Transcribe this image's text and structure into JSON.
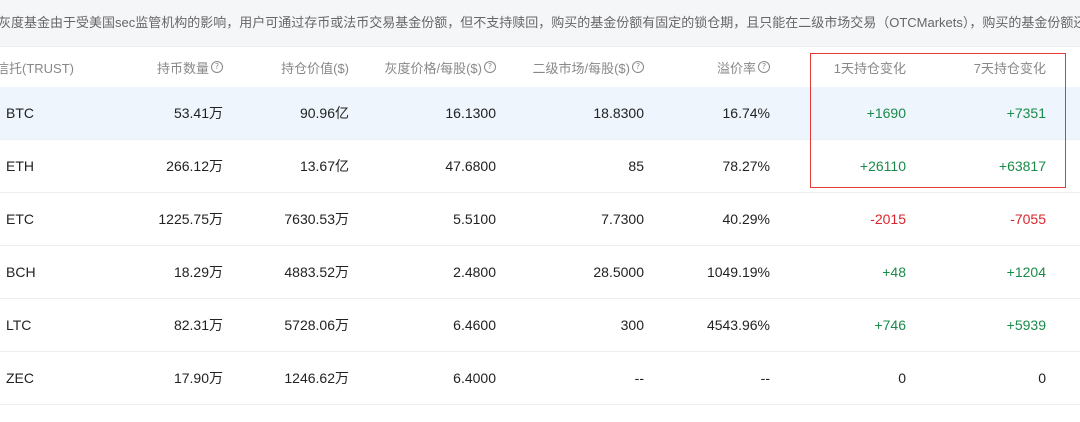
{
  "notice": {
    "text": "灰度基金由于受美国sec监管机构的影响，用户可通过存币或法币交易基金份额，但不支持赎回，购买的基金份额有固定的锁仓期，且只能在二级市场交易（OTCMarkets），购买的基金份额还需要支付基金管"
  },
  "table": {
    "headers": {
      "trust": "信托(TRUST)",
      "holdings": "持币数量",
      "value": "持仓价值($)",
      "grayscale_price": "灰度价格/每股($)",
      "secondary_price": "二级市场/每股($)",
      "premium": "溢价率",
      "change_1d": "1天持仓变化",
      "change_7d": "7天持仓变化"
    },
    "rows": [
      {
        "name": "BTC",
        "holdings": "53.41万",
        "value": "90.96亿",
        "grayscale_price": "16.1300",
        "secondary_price": "18.8300",
        "premium": "16.74%",
        "change_1d": "+1690",
        "change_1d_sign": "pos",
        "change_7d": "+7351",
        "change_7d_sign": "pos"
      },
      {
        "name": "ETH",
        "holdings": "266.12万",
        "value": "13.67亿",
        "grayscale_price": "47.6800",
        "secondary_price": "85",
        "premium": "78.27%",
        "change_1d": "+26110",
        "change_1d_sign": "pos",
        "change_7d": "+63817",
        "change_7d_sign": "pos"
      },
      {
        "name": "ETC",
        "holdings": "1225.75万",
        "value": "7630.53万",
        "grayscale_price": "5.5100",
        "secondary_price": "7.7300",
        "premium": "40.29%",
        "change_1d": "-2015",
        "change_1d_sign": "neg",
        "change_7d": "-7055",
        "change_7d_sign": "neg"
      },
      {
        "name": "BCH",
        "holdings": "18.29万",
        "value": "4883.52万",
        "grayscale_price": "2.4800",
        "secondary_price": "28.5000",
        "premium": "1049.19%",
        "change_1d": "+48",
        "change_1d_sign": "pos",
        "change_7d": "+1204",
        "change_7d_sign": "pos"
      },
      {
        "name": "LTC",
        "holdings": "82.31万",
        "value": "5728.06万",
        "grayscale_price": "6.4600",
        "secondary_price": "300",
        "premium": "4543.96%",
        "change_1d": "+746",
        "change_1d_sign": "pos",
        "change_7d": "+5939",
        "change_7d_sign": "pos"
      },
      {
        "name": "ZEC",
        "holdings": "17.90万",
        "value": "1246.62万",
        "grayscale_price": "6.4000",
        "secondary_price": "--",
        "premium": "--",
        "change_1d": "0",
        "change_1d_sign": "neu",
        "change_7d": "0",
        "change_7d_sign": "neu"
      }
    ]
  },
  "icons": {
    "help": "question-circle-icon"
  },
  "colors": {
    "positive": "#1a8a4a",
    "negative": "#d9262d",
    "highlight_row": "#eef5fd",
    "annotation_box": "#e53935"
  }
}
